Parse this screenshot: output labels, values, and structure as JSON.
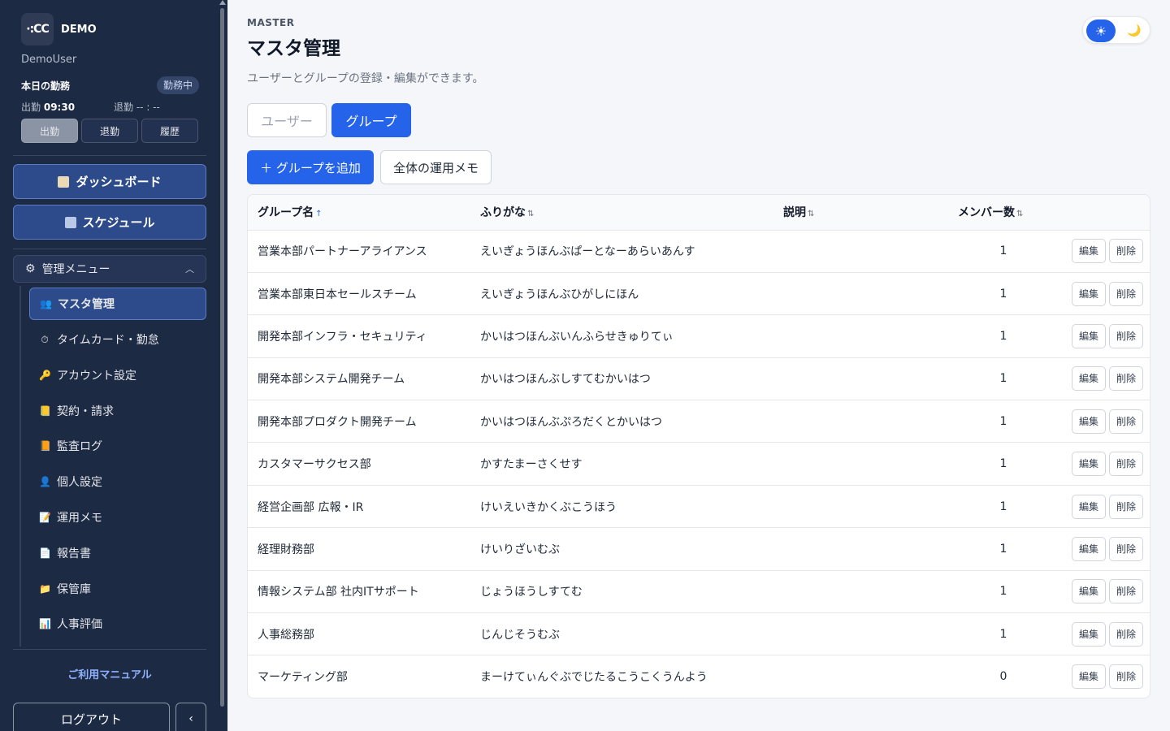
{
  "sidebar": {
    "brand_logo": "·:CC",
    "brand_name": "DEMO",
    "user_name": "DemoUser",
    "attendance": {
      "title": "本日の勤務",
      "status": "勤務中",
      "clock_in_label": "出勤",
      "clock_in_time": "09:30",
      "clock_out_label": "退勤",
      "clock_out_time": "-- : --",
      "buttons": {
        "clock_in": "出勤",
        "clock_out": "退勤",
        "history": "履歴"
      }
    },
    "nav": {
      "dashboard": "ダッシュボード",
      "schedule": "スケジュール"
    },
    "admin_menu": {
      "label": "管理メニュー",
      "items": [
        {
          "label": "マスタ管理",
          "icon": "users-icon"
        },
        {
          "label": "タイムカード・勤怠",
          "icon": "stopwatch-icon"
        },
        {
          "label": "アカウント設定",
          "icon": "key-icon"
        },
        {
          "label": "契約・請求",
          "icon": "ledger-icon"
        },
        {
          "label": "監査ログ",
          "icon": "notebook-icon"
        },
        {
          "label": "個人設定",
          "icon": "person-icon"
        },
        {
          "label": "運用メモ",
          "icon": "memo-icon"
        },
        {
          "label": "報告書",
          "icon": "document-icon"
        },
        {
          "label": "保管庫",
          "icon": "folder-icon"
        },
        {
          "label": "人事評価",
          "icon": "bar-chart-icon"
        }
      ]
    },
    "manual_link": "ご利用マニュアル",
    "logout": "ログアウト",
    "collapse": "‹"
  },
  "header": {
    "eyebrow": "MASTER",
    "title": "マスタ管理",
    "description": "ユーザーとグループの登録・編集ができます。"
  },
  "theme": {
    "light_icon": "☀",
    "dark_icon": "🌙"
  },
  "tabs": {
    "users": "ユーザー",
    "groups": "グループ"
  },
  "toolbar": {
    "add_group": "＋ グループを追加",
    "global_memo": "全体の運用メモ"
  },
  "table": {
    "columns": {
      "name": "グループ名",
      "kana": "ふりがな",
      "desc": "説明",
      "count": "メンバー数"
    },
    "sort_active": "↑",
    "sort_idle": "⇅",
    "edit_label": "編集",
    "delete_label": "削除",
    "rows": [
      {
        "name": "営業本部パートナーアライアンス",
        "kana": "えいぎょうほんぶぱーとなーあらいあんす",
        "desc": "",
        "count": "1"
      },
      {
        "name": "営業本部東日本セールスチーム",
        "kana": "えいぎょうほんぶひがしにほん",
        "desc": "",
        "count": "1"
      },
      {
        "name": "開発本部インフラ・セキュリティ",
        "kana": "かいはつほんぶいんふらせきゅりてぃ",
        "desc": "",
        "count": "1"
      },
      {
        "name": "開発本部システム開発チーム",
        "kana": "かいはつほんぶしすてむかいはつ",
        "desc": "",
        "count": "1"
      },
      {
        "name": "開発本部プロダクト開発チーム",
        "kana": "かいはつほんぶぷろだくとかいはつ",
        "desc": "",
        "count": "1"
      },
      {
        "name": "カスタマーサクセス部",
        "kana": "かすたまーさくせす",
        "desc": "",
        "count": "1"
      },
      {
        "name": "経営企画部 広報・IR",
        "kana": "けいえいきかくぶこうほう",
        "desc": "",
        "count": "1"
      },
      {
        "name": "経理財務部",
        "kana": "けいりざいむぶ",
        "desc": "",
        "count": "1"
      },
      {
        "name": "情報システム部 社内ITサポート",
        "kana": "じょうほうしすてむ",
        "desc": "",
        "count": "1"
      },
      {
        "name": "人事総務部",
        "kana": "じんじそうむぶ",
        "desc": "",
        "count": "1"
      },
      {
        "name": "マーケティング部",
        "kana": "まーけてぃんぐぶでじたるこうこくうんよう",
        "desc": "",
        "count": "0"
      }
    ]
  }
}
